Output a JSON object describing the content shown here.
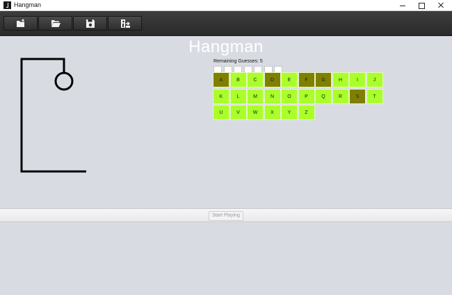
{
  "window": {
    "title": "Hangman",
    "icon": "hangman-app-icon"
  },
  "toolbar": {
    "buttons": [
      {
        "id": "new",
        "icon": "new-game-icon"
      },
      {
        "id": "open",
        "icon": "open-folder-icon"
      },
      {
        "id": "save",
        "icon": "save-icon"
      },
      {
        "id": "exit",
        "icon": "exit-icon"
      }
    ]
  },
  "game": {
    "title": "Hangman",
    "remaining_label": "Remaining Guesses: 5",
    "remaining_guesses": 5,
    "word_slots": 7,
    "letters": [
      {
        "char": "A",
        "used": true
      },
      {
        "char": "B",
        "used": false
      },
      {
        "char": "C",
        "used": false
      },
      {
        "char": "D",
        "used": true
      },
      {
        "char": "E",
        "used": false
      },
      {
        "char": "F",
        "used": true
      },
      {
        "char": "G",
        "used": true
      },
      {
        "char": "H",
        "used": false
      },
      {
        "char": "I",
        "used": false
      },
      {
        "char": "J",
        "used": false
      },
      {
        "char": "K",
        "used": false
      },
      {
        "char": "L",
        "used": false
      },
      {
        "char": "M",
        "used": false
      },
      {
        "char": "N",
        "used": false
      },
      {
        "char": "O",
        "used": false
      },
      {
        "char": "P",
        "used": false
      },
      {
        "char": "Q",
        "used": false
      },
      {
        "char": "R",
        "used": false
      },
      {
        "char": "S",
        "used": true
      },
      {
        "char": "T",
        "used": false
      },
      {
        "char": "U",
        "used": false
      },
      {
        "char": "V",
        "used": false
      },
      {
        "char": "W",
        "used": false
      },
      {
        "char": "X",
        "used": false
      },
      {
        "char": "Y",
        "used": false
      },
      {
        "char": "Z",
        "used": false
      }
    ],
    "colors": {
      "available": "#aaff2a",
      "used": "#808000"
    }
  },
  "footer": {
    "start_label": "Start Playing"
  }
}
